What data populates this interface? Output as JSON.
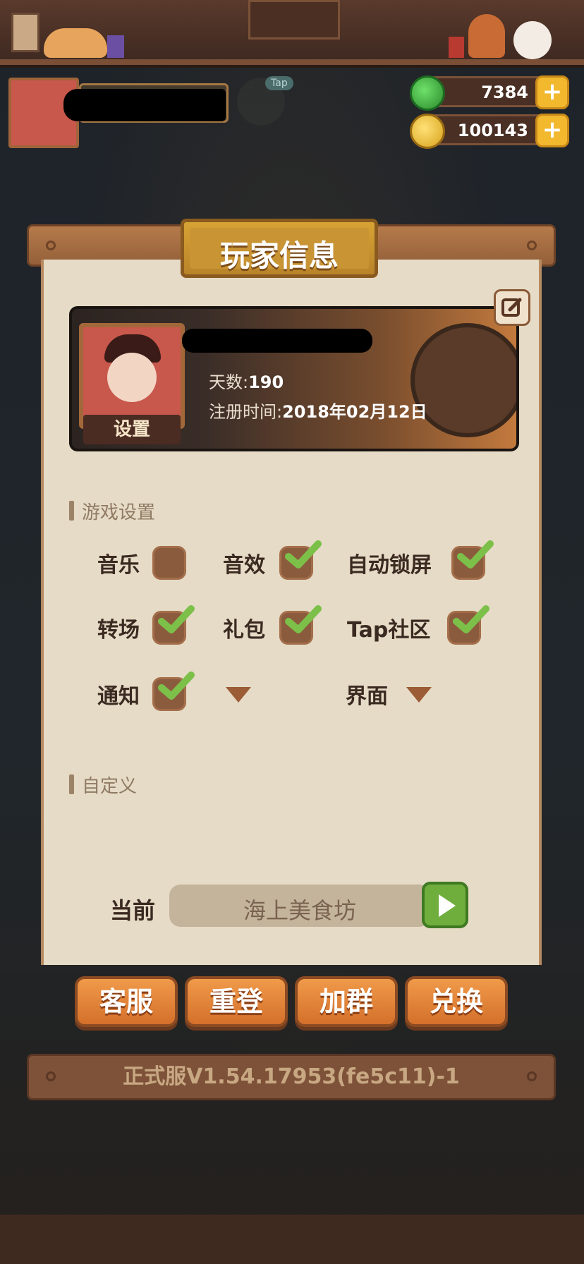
{
  "currency": {
    "jade": "7384",
    "coins": "100143"
  },
  "panel": {
    "title": "玩家信息",
    "profile": {
      "set_label": "设置",
      "days_label": "天数:",
      "days_value": "190",
      "reg_label": "注册时间:",
      "reg_value": "2018年02月12日"
    },
    "game_settings": {
      "header": "游戏设置",
      "options": [
        {
          "label": "音乐",
          "checked": false
        },
        {
          "label": "音效",
          "checked": true
        },
        {
          "label": "自动锁屏",
          "checked": true
        },
        {
          "label": "转场",
          "checked": true
        },
        {
          "label": "礼包",
          "checked": true
        },
        {
          "label": "Tap社区",
          "checked": true
        },
        {
          "label": "通知",
          "checked": true
        },
        {
          "label": "",
          "dropdown": true
        },
        {
          "label": "界面",
          "dropdown": true
        }
      ]
    },
    "custom": {
      "header": "自定义",
      "current_label": "当前",
      "current_value": "海上美食坊"
    },
    "buttons": {
      "service": "客服",
      "relogin": "重登",
      "join_group": "加群",
      "redeem": "兑换"
    },
    "version": "正式服V1.54.17953(fe5c11)-1"
  },
  "tap_badge": "Tap",
  "colors": {
    "panel_bg": "#e6dbc6",
    "button_orange": "#e8863c",
    "title_gold": "#c99434",
    "check_green": "#7cc04a"
  }
}
